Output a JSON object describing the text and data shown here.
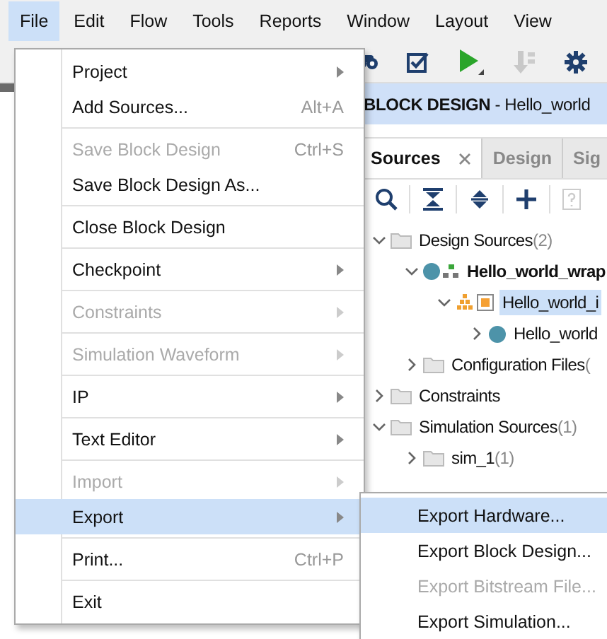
{
  "menubar": [
    {
      "label": "File",
      "selected": true
    },
    {
      "label": "Edit",
      "selected": false
    },
    {
      "label": "Flow",
      "selected": false
    },
    {
      "label": "Tools",
      "selected": false
    },
    {
      "label": "Reports",
      "selected": false
    },
    {
      "label": "Window",
      "selected": false
    },
    {
      "label": "Layout",
      "selected": false
    },
    {
      "label": "View",
      "selected": false
    }
  ],
  "banner": {
    "title": "**BLOCK DESIGN** - Hello_world"
  },
  "sources_panel": {
    "tabs": [
      {
        "label": "Sources",
        "selected": true,
        "closable": true
      },
      {
        "label": "Design",
        "selected": false,
        "closable": false
      },
      {
        "label": "Sig",
        "selected": false,
        "closable": false
      }
    ],
    "tree": [
      {
        "label": "Design Sources",
        "count": "(2)",
        "kind": "folder",
        "expanded": true,
        "bold": false,
        "selected": false,
        "children": [
          {
            "label": "Hello_world_wrap",
            "kind": "wrapper",
            "expanded": true,
            "bold": true,
            "selected": false,
            "children": [
              {
                "label": "Hello_world_i",
                "kind": "block-design",
                "expanded": true,
                "bold": false,
                "selected": true,
                "children": [
                  {
                    "label": "Hello_world",
                    "kind": "module",
                    "expanded": false,
                    "bold": false,
                    "selected": false
                  }
                ]
              }
            ]
          },
          {
            "label": "Configuration Files",
            "count": "(",
            "kind": "folder",
            "expanded": false,
            "bold": false,
            "selected": false
          }
        ]
      },
      {
        "label": "Constraints",
        "kind": "folder",
        "expanded": false,
        "bold": false,
        "selected": false
      },
      {
        "label": "Simulation Sources",
        "count": "(1)",
        "kind": "folder",
        "expanded": true,
        "bold": false,
        "selected": false,
        "children": [
          {
            "label": "sim_1",
            "count": "(1)",
            "kind": "folder",
            "expanded": false,
            "bold": false,
            "selected": false
          }
        ]
      }
    ]
  },
  "file_menu": [
    {
      "kind": "item",
      "label": "Project",
      "submenu": true,
      "disabled": false,
      "selected": false
    },
    {
      "kind": "item",
      "label": "Add Sources...",
      "shortcut": "Alt+A",
      "submenu": false,
      "disabled": false,
      "selected": false
    },
    {
      "kind": "separator"
    },
    {
      "kind": "item",
      "label": "Save Block Design",
      "shortcut": "Ctrl+S",
      "submenu": false,
      "disabled": true,
      "selected": false
    },
    {
      "kind": "item",
      "label": "Save Block Design As...",
      "submenu": false,
      "disabled": false,
      "selected": false
    },
    {
      "kind": "separator"
    },
    {
      "kind": "item",
      "label": "Close Block Design",
      "submenu": false,
      "disabled": false,
      "selected": false
    },
    {
      "kind": "separator"
    },
    {
      "kind": "item",
      "label": "Checkpoint",
      "submenu": true,
      "disabled": false,
      "selected": false
    },
    {
      "kind": "separator"
    },
    {
      "kind": "item",
      "label": "Constraints",
      "submenu": true,
      "disabled": true,
      "selected": false
    },
    {
      "kind": "separator"
    },
    {
      "kind": "item",
      "label": "Simulation Waveform",
      "submenu": true,
      "disabled": true,
      "selected": false
    },
    {
      "kind": "separator"
    },
    {
      "kind": "item",
      "label": "IP",
      "submenu": true,
      "disabled": false,
      "selected": false
    },
    {
      "kind": "separator"
    },
    {
      "kind": "item",
      "label": "Text Editor",
      "submenu": true,
      "disabled": false,
      "selected": false
    },
    {
      "kind": "separator"
    },
    {
      "kind": "item",
      "label": "Import",
      "submenu": true,
      "disabled": true,
      "selected": false
    },
    {
      "kind": "item",
      "label": "Export",
      "submenu": true,
      "disabled": false,
      "selected": true
    },
    {
      "kind": "separator"
    },
    {
      "kind": "item",
      "label": "Print...",
      "shortcut": "Ctrl+P",
      "submenu": false,
      "disabled": false,
      "selected": false
    },
    {
      "kind": "separator"
    },
    {
      "kind": "item",
      "label": "Exit",
      "submenu": false,
      "disabled": false,
      "selected": false
    }
  ],
  "export_submenu": [
    {
      "label": "Export Hardware...",
      "disabled": false,
      "selected": true
    },
    {
      "label": "Export Block Design...",
      "disabled": false,
      "selected": false
    },
    {
      "label": "Export Bitstream File...",
      "disabled": true,
      "selected": false
    },
    {
      "label": "Export Simulation...",
      "disabled": false,
      "selected": false
    }
  ]
}
